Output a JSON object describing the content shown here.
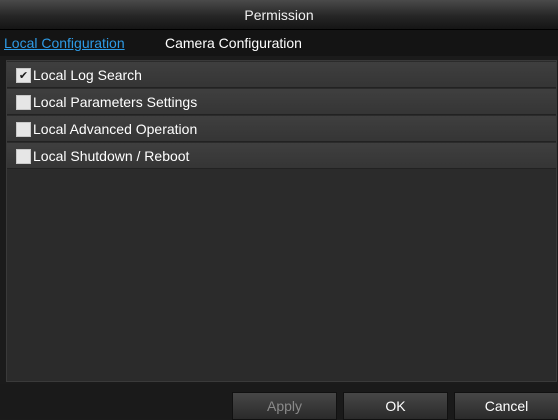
{
  "window": {
    "title": "Permission"
  },
  "tabs": [
    {
      "label": "Local Configuration",
      "active": true
    },
    {
      "label": "Camera Configuration",
      "active": false
    }
  ],
  "permissions": [
    {
      "label": "Local Log Search",
      "checked": true
    },
    {
      "label": "Local Parameters Settings",
      "checked": false
    },
    {
      "label": "Local Advanced Operation",
      "checked": false
    },
    {
      "label": "Local Shutdown / Reboot",
      "checked": false
    }
  ],
  "buttons": {
    "apply_label": "Apply",
    "ok_label": "OK",
    "cancel_label": "Cancel"
  },
  "colors": {
    "accent": "#2e9be6",
    "background": "#1b1b1b",
    "row": "#3a3a3a"
  }
}
